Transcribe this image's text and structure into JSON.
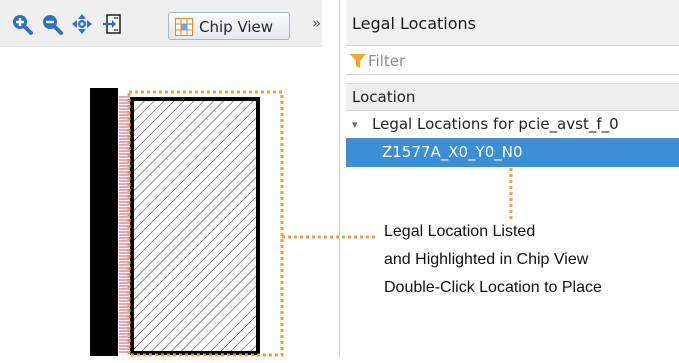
{
  "toolbar": {
    "icons": [
      "zoom-in-icon",
      "zoom-out-icon",
      "pan-icon",
      "fit-view-icon"
    ],
    "chip_view_label": "Chip View",
    "overflow_label": "»"
  },
  "legal_locations": {
    "title": "Legal Locations",
    "filter_placeholder": "Filter",
    "column_header": "Location",
    "group_label": "Legal Locations for pcie_avst_f_0",
    "selected_location": "Z1577A_X0_Y0_N0"
  },
  "callout": {
    "line1": "Legal Location Listed",
    "line2": "and Highlighted in Chip View",
    "line3": "Double-Click Location to Place"
  },
  "colors": {
    "selection_blue": "#3b8fd6",
    "highlight_orange": "#f0a040",
    "filter_orange": "#f5a623",
    "chip_pins": "#d34b6b",
    "zoom_icon_blue": "#2b6fcf"
  }
}
